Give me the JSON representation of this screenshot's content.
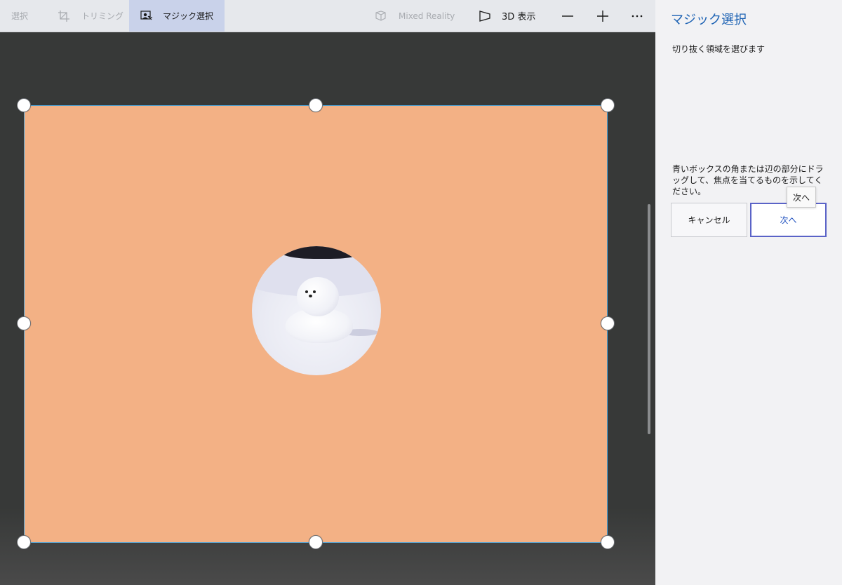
{
  "toolbar": {
    "select_label": "選択",
    "trim_label": "トリミング",
    "magic_label": "マジック選択",
    "mixed_reality_label": "Mixed Reality",
    "view3d_label": "3D 表示",
    "icons": {
      "trim": "crop-icon",
      "magic": "magic-select-icon",
      "mixed_reality": "mixed-reality-icon",
      "view3d": "3d-view-icon",
      "zoom_out": "minus-icon",
      "zoom_in": "plus-icon",
      "more": "more-icon"
    }
  },
  "panel": {
    "title": "マジック選択",
    "subtitle": "切り抜く領域を選びます",
    "instruction": "青いボックスの角または辺の部分にドラッグして、焦点を当てるものを示してください。",
    "cancel_label": "キャンセル",
    "next_label": "次へ",
    "tooltip": "次へ"
  },
  "colors": {
    "accent": "#1e63b4",
    "canvas_bg": "#373938",
    "image_fill": "#f3b185",
    "selection_border": "#4ea3d6",
    "next_button_border": "#5a63c7"
  }
}
